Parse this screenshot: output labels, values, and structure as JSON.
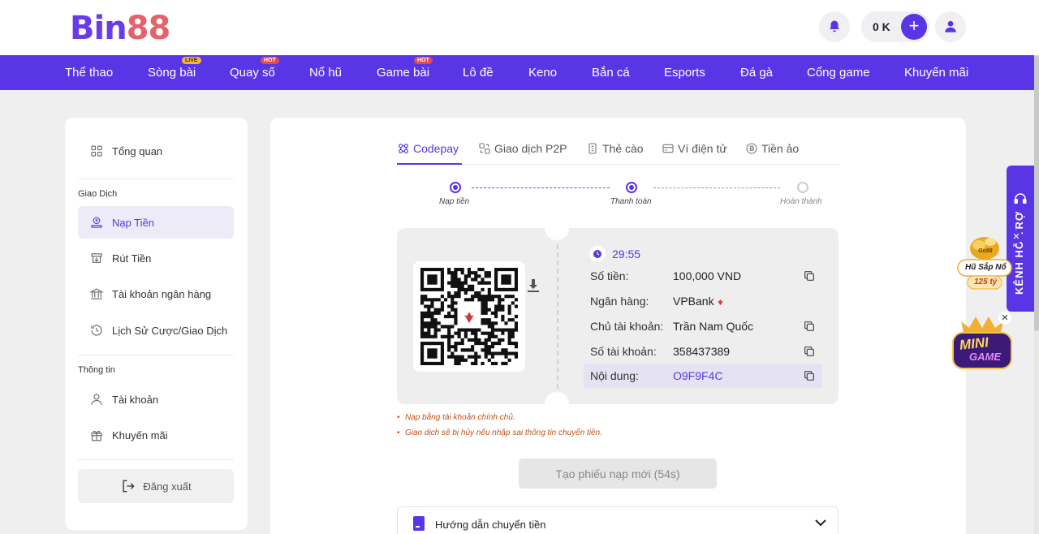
{
  "header": {
    "logo_prefix": "Bin",
    "logo_suffix": "88",
    "balance": "0 K"
  },
  "nav": {
    "items": [
      {
        "label": "Thể thao",
        "badge": ""
      },
      {
        "label": "Sòng bài",
        "badge": "LIVE"
      },
      {
        "label": "Quay số",
        "badge": "HOT"
      },
      {
        "label": "Nổ hũ",
        "badge": ""
      },
      {
        "label": "Game bài",
        "badge": "HOT"
      },
      {
        "label": "Lô đề",
        "badge": ""
      },
      {
        "label": "Keno",
        "badge": ""
      },
      {
        "label": "Bắn cá",
        "badge": ""
      },
      {
        "label": "Esports",
        "badge": ""
      },
      {
        "label": "Đá gà",
        "badge": ""
      },
      {
        "label": "Cổng game",
        "badge": ""
      },
      {
        "label": "Khuyến mãi",
        "badge": ""
      }
    ]
  },
  "sidebar": {
    "overview": "Tổng quan",
    "section_transactions": "Giao Dịch",
    "deposit": "Nạp Tiền",
    "withdraw": "Rút Tiền",
    "bank_account": "Tài khoản ngân hàng",
    "history": "Lịch Sử Cược/Giao Dịch",
    "section_info": "Thông tin",
    "account": "Tài khoản",
    "promotions": "Khuyến mãi",
    "logout": "Đăng xuất"
  },
  "tabs": [
    {
      "label": "Codepay",
      "active": true
    },
    {
      "label": "Giao dịch P2P",
      "active": false
    },
    {
      "label": "Thẻ cào",
      "active": false
    },
    {
      "label": "Ví điện tử",
      "active": false
    },
    {
      "label": "Tiền ảo",
      "active": false
    }
  ],
  "steps": [
    {
      "label": "Nạp tiền",
      "done": true
    },
    {
      "label": "Thanh toán",
      "done": true
    },
    {
      "label": "Hoàn thành",
      "done": false
    }
  ],
  "payment": {
    "timer": "29:55",
    "amount_label": "Số tiền:",
    "amount": "100,000 VND",
    "bank_label": "Ngân hàng:",
    "bank": "VPBank",
    "holder_label": "Chủ tài khoản:",
    "holder": "Trần Nam Quốc",
    "account_label": "Số tài khoản:",
    "account": "358437389",
    "content_label": "Nội dung:",
    "content": "O9F9F4C"
  },
  "notes": [
    "Nạp bằng tài khoản chính chủ.",
    "Giao dịch sẽ bị hủy nếu nhập sai thông tin chuyển tiền."
  ],
  "new_slip_button": "Tạo phiếu nạp mới  (54s)",
  "guide_label": "Hướng dẫn chuyển tiền",
  "support_label": "KÊNH HỖ TRỢ",
  "promo": {
    "brand": "Go88",
    "jackpot_label": "Hũ Sắp Nổ",
    "jackpot_value": "125 tỷ",
    "mini_game_line1": "MINI",
    "mini_game_line2": "GAME"
  },
  "colors": {
    "primary": "#5a35e6",
    "note": "#c0531a"
  }
}
